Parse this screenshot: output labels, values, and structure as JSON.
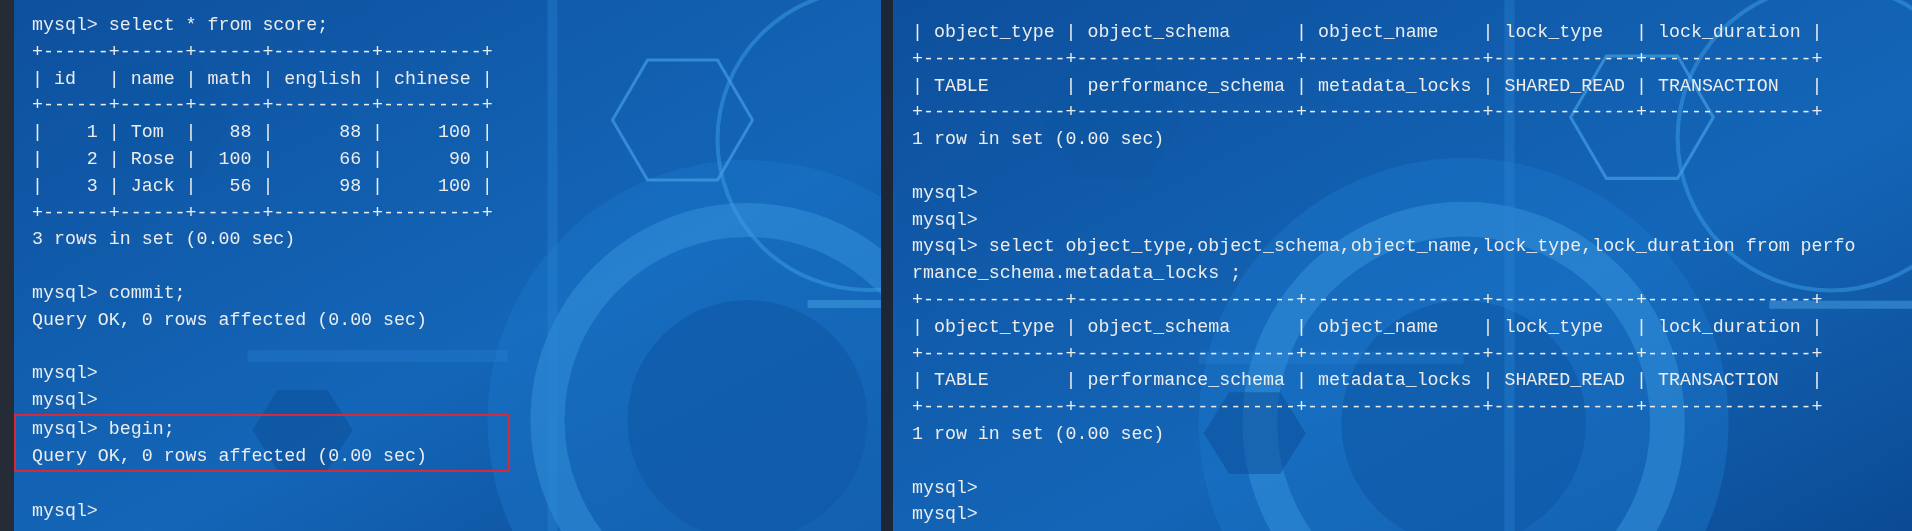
{
  "terminals": [
    {
      "blocks": [
        {
          "lines": [
            "mysql> select * from score;",
            "+------+------+------+---------+---------+",
            "| id   | name | math | english | chinese |",
            "+------+------+------+---------+---------+",
            "|    1 | Tom  |   88 |      88 |     100 |",
            "|    2 | Rose |  100 |      66 |      90 |",
            "|    3 | Jack |   56 |      98 |     100 |",
            "+------+------+------+---------+---------+",
            "3 rows in set (0.00 sec)"
          ]
        },
        {
          "lines": [
            "mysql> commit;",
            "Query OK, 0 rows affected (0.00 sec)"
          ]
        },
        {
          "lines": [
            "mysql>",
            "mysql>"
          ],
          "highlighted_lines": [
            "mysql> begin;",
            "Query OK, 0 rows affected (0.00 sec)"
          ]
        },
        {
          "lines": [
            "mysql>"
          ]
        }
      ]
    },
    {
      "blocks": [
        {
          "lines": [
            "| object_type | object_schema      | object_name    | lock_type   | lock_duration |",
            "+-------------+--------------------+----------------+-------------+---------------+",
            "| TABLE       | performance_schema | metadata_locks | SHARED_READ | TRANSACTION   |",
            "+-------------+--------------------+----------------+-------------+---------------+",
            "1 row in set (0.00 sec)"
          ]
        },
        {
          "lines": [
            "mysql>",
            "mysql>",
            "mysql> select object_type,object_schema,object_name,lock_type,lock_duration from perfo",
            "rmance_schema.metadata_locks ;",
            "+-------------+--------------------+----------------+-------------+---------------+",
            "| object_type | object_schema      | object_name    | lock_type   | lock_duration |",
            "+-------------+--------------------+----------------+-------------+---------------+",
            "| TABLE       | performance_schema | metadata_locks | SHARED_READ | TRANSACTION   |",
            "+-------------+--------------------+----------------+-------------+---------------+",
            "1 row in set (0.00 sec)"
          ]
        },
        {
          "lines": [
            "mysql>",
            "mysql>"
          ]
        }
      ]
    }
  ]
}
